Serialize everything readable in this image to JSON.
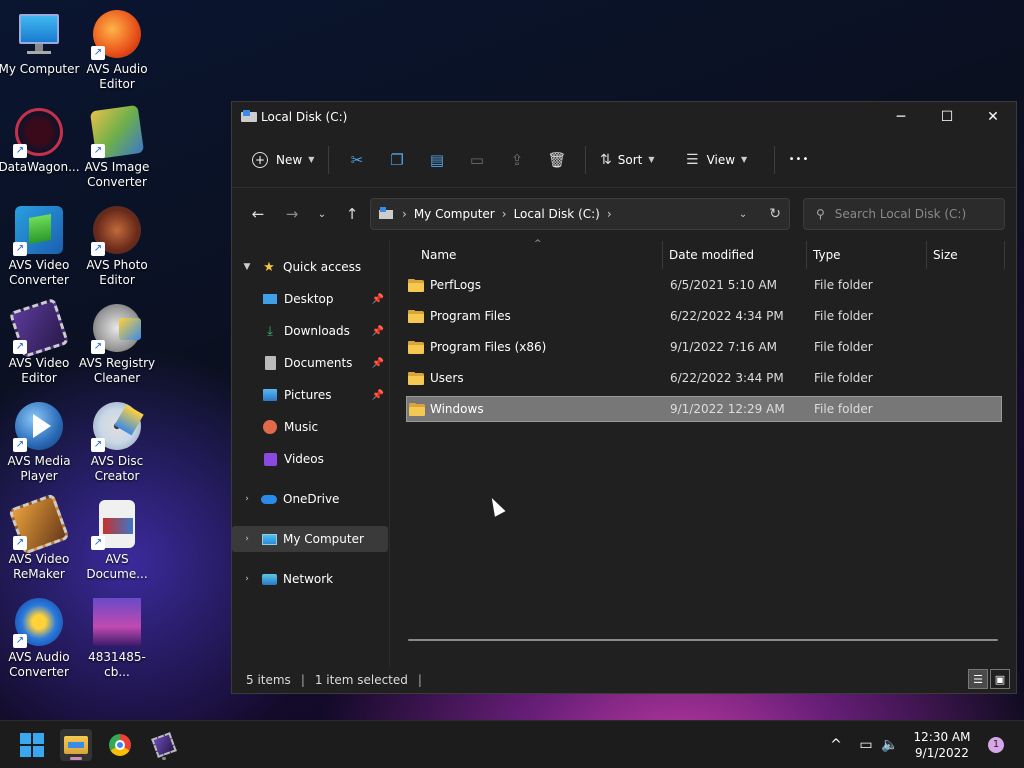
{
  "desktop": {
    "icons": [
      {
        "label": "My Computer",
        "icon": "monitor-icon",
        "shortcut": false
      },
      {
        "label": "AVS Audio Editor",
        "icon": "audio-editor-icon",
        "shortcut": true
      },
      {
        "label": "DataWagon...",
        "icon": "datawagon-icon",
        "shortcut": true
      },
      {
        "label": "AVS Image Converter",
        "icon": "image-converter-icon",
        "shortcut": true
      },
      {
        "label": "AVS Video Converter",
        "icon": "video-converter-icon",
        "shortcut": true
      },
      {
        "label": "AVS Photo Editor",
        "icon": "photo-editor-icon",
        "shortcut": true
      },
      {
        "label": "AVS Video Editor",
        "icon": "video-editor-icon",
        "shortcut": true
      },
      {
        "label": "AVS Registry Cleaner",
        "icon": "registry-cleaner-icon",
        "shortcut": true
      },
      {
        "label": "AVS Media Player",
        "icon": "media-player-icon",
        "shortcut": true
      },
      {
        "label": "AVS Disc Creator",
        "icon": "disc-creator-icon",
        "shortcut": true
      },
      {
        "label": "AVS Video ReMaker",
        "icon": "video-remaker-icon",
        "shortcut": true
      },
      {
        "label": "AVS Docume...",
        "icon": "document-converter-icon",
        "shortcut": true
      },
      {
        "label": "AVS Audio Converter",
        "icon": "audio-converter-icon",
        "shortcut": true
      },
      {
        "label": "4831485-cb...",
        "icon": "image-file-icon",
        "shortcut": false
      }
    ]
  },
  "window": {
    "title": "Local Disk (C:)",
    "controls": {
      "minimize": "─",
      "maximize": "☐",
      "close": "✕"
    }
  },
  "toolbar": {
    "new_label": "New",
    "sort_label": "Sort",
    "view_label": "View",
    "more_label": "•••"
  },
  "address": {
    "crumbs": [
      "My Computer",
      "Local Disk (C:)"
    ],
    "search_placeholder": "Search Local Disk (C:)"
  },
  "nav_pane": {
    "quick_access": "Quick access",
    "items": [
      {
        "label": "Desktop",
        "pinned": true
      },
      {
        "label": "Downloads",
        "pinned": true
      },
      {
        "label": "Documents",
        "pinned": true
      },
      {
        "label": "Pictures",
        "pinned": true
      },
      {
        "label": "Music",
        "pinned": false
      },
      {
        "label": "Videos",
        "pinned": false
      }
    ],
    "onedrive": "OneDrive",
    "my_computer": "My Computer",
    "network": "Network"
  },
  "columns": {
    "name": "Name",
    "date": "Date modified",
    "type": "Type",
    "size": "Size"
  },
  "files": [
    {
      "name": "PerfLogs",
      "date": "6/5/2021 5:10 AM",
      "type": "File folder",
      "selected": false
    },
    {
      "name": "Program Files",
      "date": "6/22/2022 4:34 PM",
      "type": "File folder",
      "selected": false
    },
    {
      "name": "Program Files (x86)",
      "date": "9/1/2022 7:16 AM",
      "type": "File folder",
      "selected": false
    },
    {
      "name": "Users",
      "date": "6/22/2022 3:44 PM",
      "type": "File folder",
      "selected": false
    },
    {
      "name": "Windows",
      "date": "9/1/2022 12:29 AM",
      "type": "File folder",
      "selected": true
    }
  ],
  "status": {
    "count": "5 items",
    "selected": "1 item selected"
  },
  "taskbar": {
    "time": "12:30 AM",
    "date": "9/1/2022",
    "notification_count": "1"
  }
}
